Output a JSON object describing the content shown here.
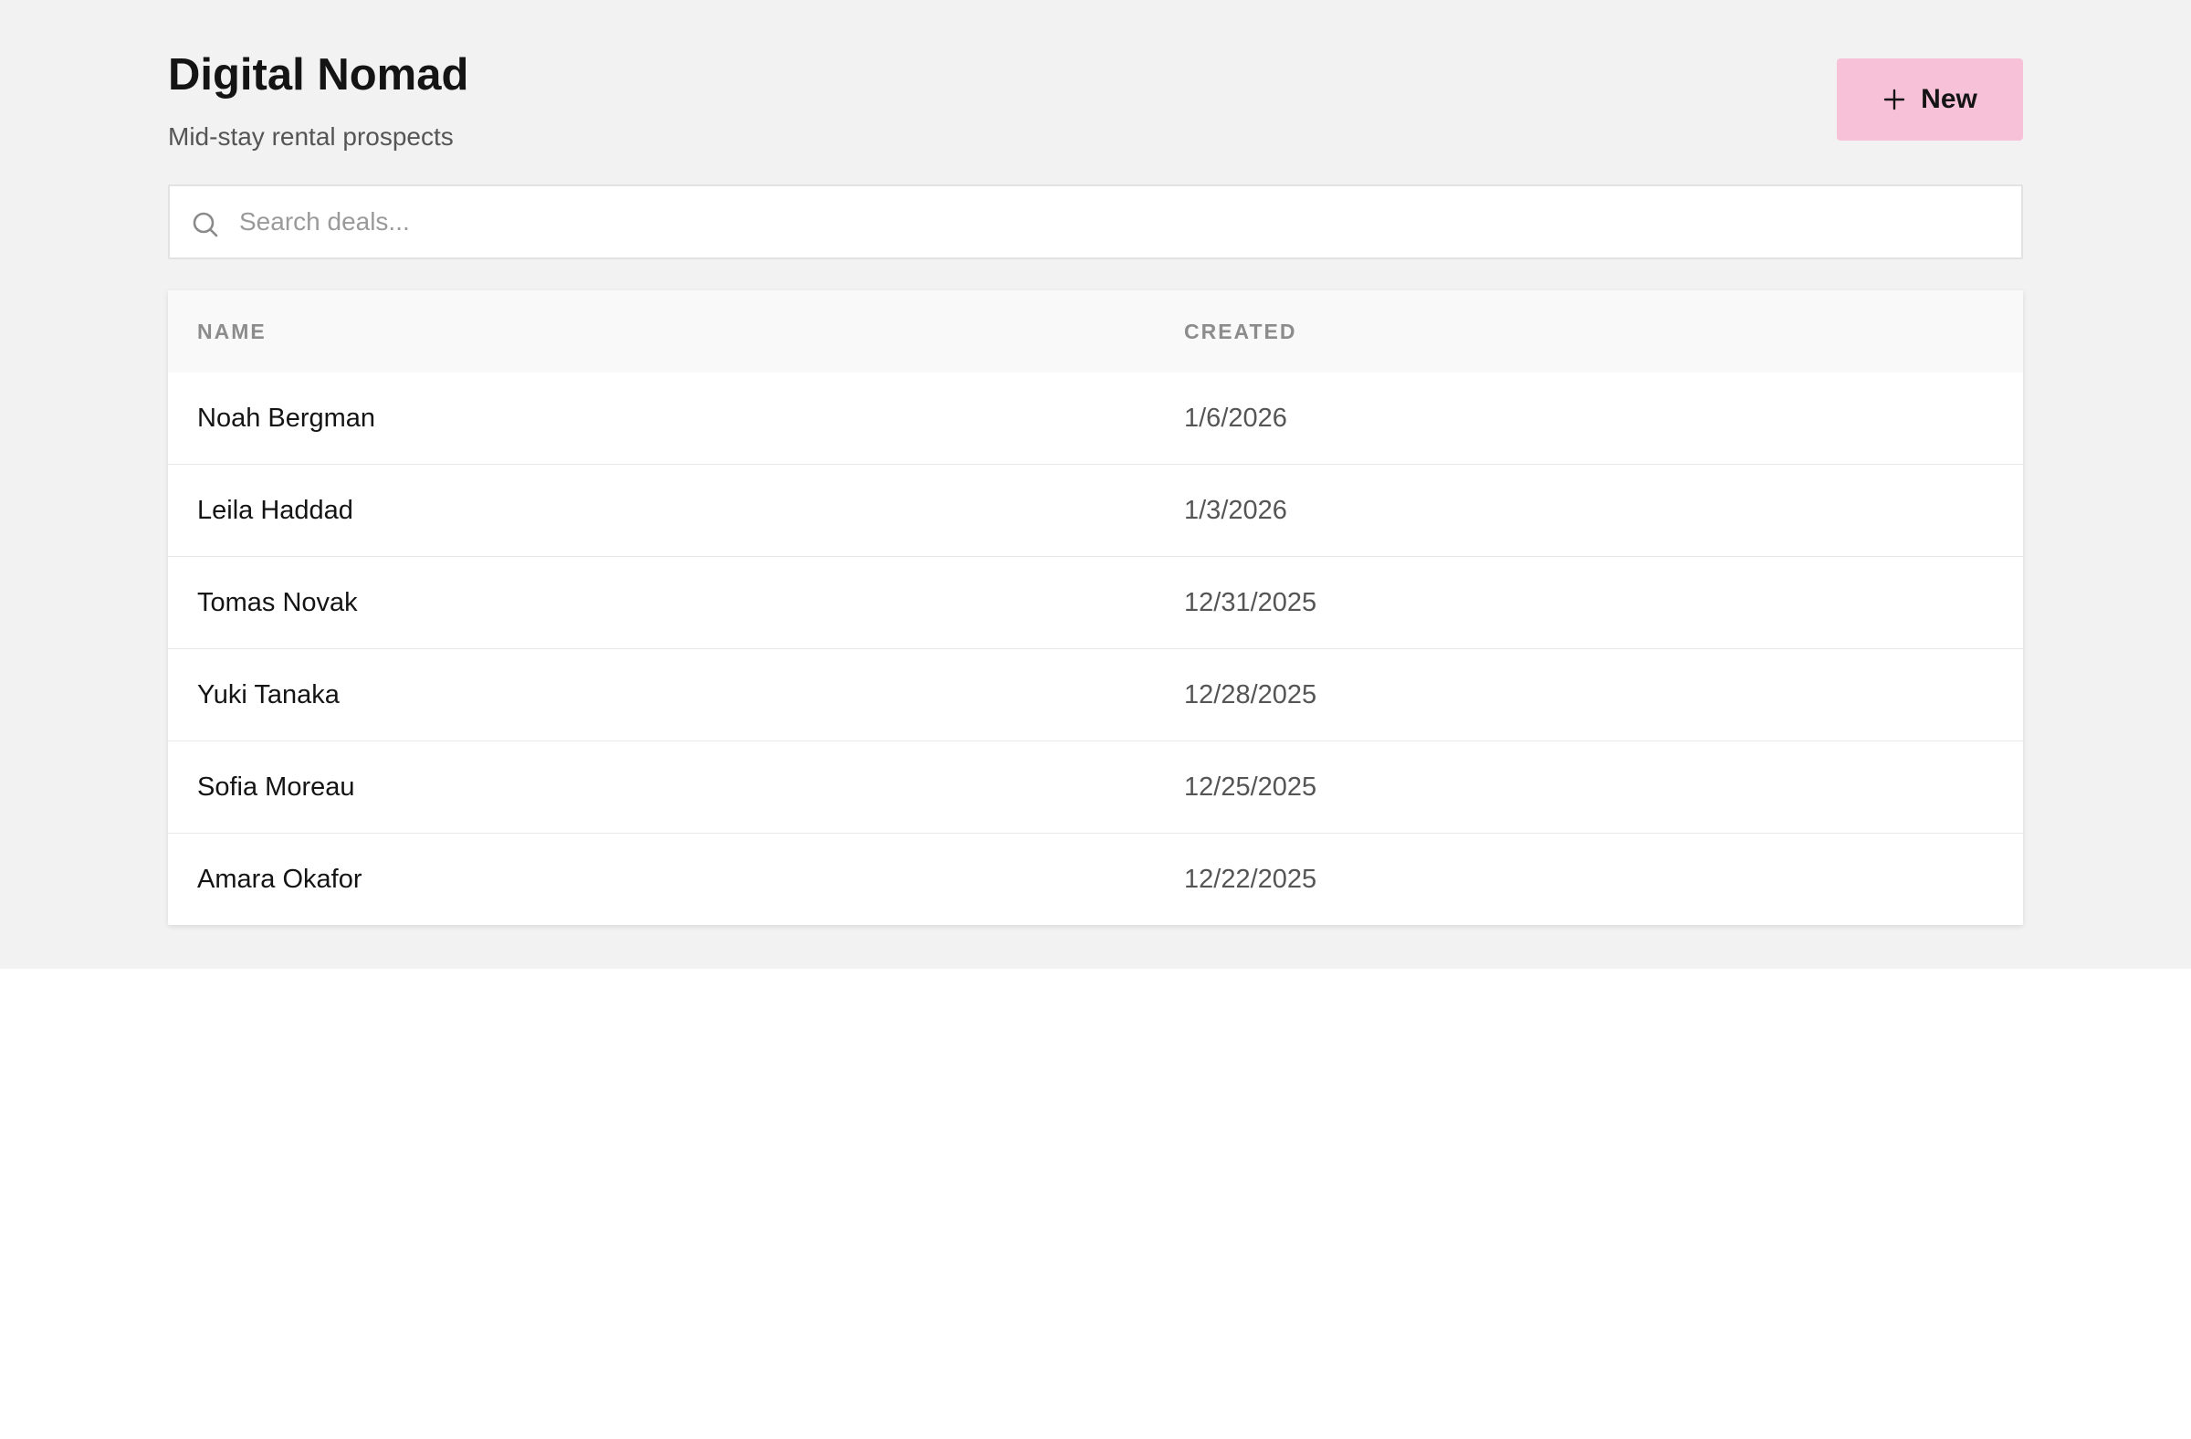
{
  "header": {
    "title": "Digital Nomad",
    "subtitle": "Mid-stay rental prospects",
    "new_button_label": "New"
  },
  "search": {
    "placeholder": "Search deals...",
    "value": ""
  },
  "table": {
    "columns": [
      "NAME",
      "CREATED"
    ],
    "rows": [
      {
        "name": "Noah Bergman",
        "created": "1/6/2026"
      },
      {
        "name": "Leila Haddad",
        "created": "1/3/2026"
      },
      {
        "name": "Tomas Novak",
        "created": "12/31/2025"
      },
      {
        "name": "Yuki Tanaka",
        "created": "12/28/2025"
      },
      {
        "name": "Sofia Moreau",
        "created": "12/25/2025"
      },
      {
        "name": "Amara Okafor",
        "created": "12/22/2025"
      }
    ]
  },
  "icons": {
    "new_button": "plus-icon",
    "search": "search-icon"
  },
  "colors": {
    "accent": "#f7c2d8",
    "page_background": "#f2f2f2"
  }
}
